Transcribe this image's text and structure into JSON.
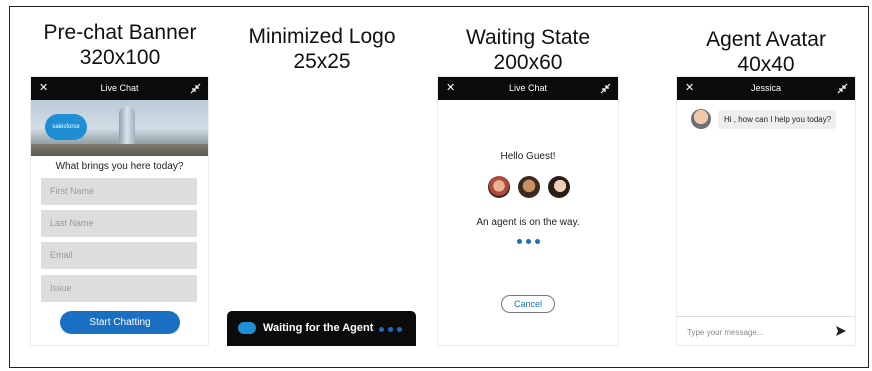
{
  "headings": {
    "prechat": {
      "line1": "Pre-chat Banner",
      "line2": "320x100"
    },
    "minimized": {
      "line1": "Minimized Logo",
      "line2": "25x25"
    },
    "waiting": {
      "line1": "Waiting State",
      "line2": "200x60"
    },
    "avatar": {
      "line1": "Agent Avatar",
      "line2": "40x40"
    }
  },
  "prechat": {
    "header_title": "Live Chat",
    "close_glyph": "✕",
    "banner_logo_text": "salesforce",
    "question": "What brings you here today?",
    "fields": [
      "First Name",
      "Last Name",
      "Email",
      "Issue"
    ],
    "submit_label": "Start Chatting"
  },
  "minimized": {
    "text": "Waiting for the Agent"
  },
  "waiting": {
    "header_title": "Live Chat",
    "close_glyph": "✕",
    "greeting": "Hello Guest!",
    "status": "An agent is on the way.",
    "cancel_label": "Cancel"
  },
  "agent": {
    "header_title": "Jessica",
    "close_glyph": "✕",
    "message": "Hi , how can I help you today?",
    "input_placeholder": "Type your message..."
  },
  "colors": {
    "header_bg": "#0b0b0b",
    "accent_blue": "#1b6fc2",
    "field_bg": "#dddddd",
    "brand_cloud": "#1f8fd5"
  }
}
